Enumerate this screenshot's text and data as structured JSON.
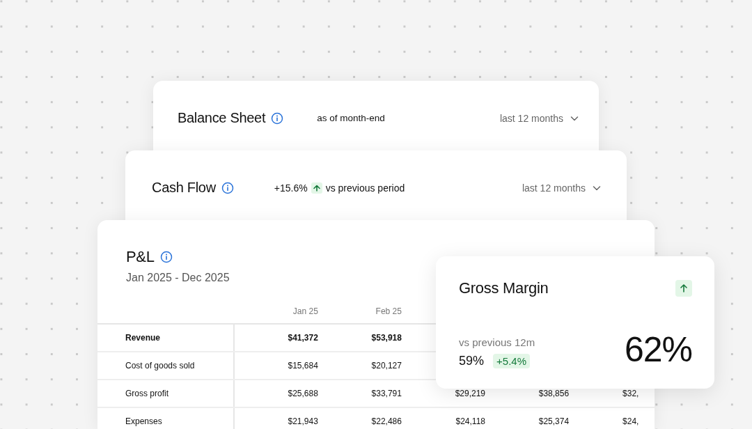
{
  "balance_sheet": {
    "title": "Balance Sheet",
    "note": "as of month-end",
    "period": "last 12 months"
  },
  "cash_flow": {
    "title": "Cash Flow",
    "change": "+15.6%",
    "note": "vs previous period",
    "period": "last 12 months"
  },
  "pnl": {
    "title": "P&L",
    "range": "Jan 2025 - Dec 2025",
    "table": {
      "columns": [
        "Jan 25",
        "Feb 25"
      ],
      "rows": [
        {
          "label": "Revenue",
          "bold": true,
          "cells": [
            "$41,372",
            "$53,918",
            null,
            null,
            null
          ]
        },
        {
          "label": "Cost of goods sold",
          "bold": false,
          "cells": [
            "$15,684",
            "$20,127",
            null,
            null,
            null
          ]
        },
        {
          "label": "Gross profit",
          "bold": false,
          "cells": [
            "$25,688",
            "$33,791",
            "$29,219",
            "$38,856",
            "$32,"
          ]
        },
        {
          "label": "Expenses",
          "bold": false,
          "cells": [
            "$21,943",
            "$22,486",
            "$24,118",
            "$25,374",
            "$24,"
          ]
        }
      ]
    }
  },
  "gross_margin": {
    "title": "Gross Margin",
    "caption": "vs previous 12m",
    "previous": "59%",
    "change": "+5.4%",
    "value": "62%"
  }
}
